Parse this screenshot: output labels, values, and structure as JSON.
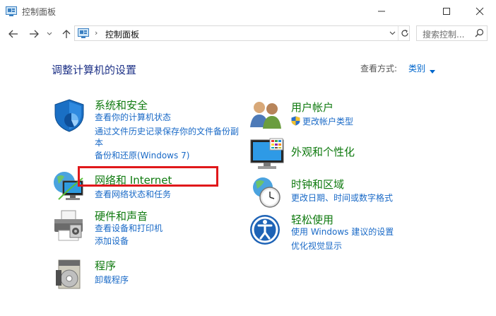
{
  "window": {
    "title": "控制面板"
  },
  "address": {
    "path": "控制面板",
    "separator": "›"
  },
  "search": {
    "placeholder": "搜索控制..."
  },
  "header": {
    "title": "调整计算机的设置",
    "view_by_label": "查看方式:",
    "view_by_value": "类别"
  },
  "left_categories": [
    {
      "title": "系统和安全",
      "links": [
        "查看你的计算机状态",
        "通过文件历史记录保存你的文件备份副",
        "本",
        "备份和还原(Windows 7)"
      ]
    },
    {
      "title": "网络和 Internet",
      "links": [
        "查看网络状态和任务"
      ]
    },
    {
      "title": "硬件和声音",
      "links": [
        "查看设备和打印机",
        "添加设备"
      ]
    },
    {
      "title": "程序",
      "links": [
        "卸载程序"
      ]
    }
  ],
  "right_categories": [
    {
      "title": "用户帐户",
      "links": [
        "更改帐户类型"
      ]
    },
    {
      "title": "外观和个性化",
      "links": []
    },
    {
      "title": "时钟和区域",
      "links": [
        "更改日期、时间或数字格式"
      ]
    },
    {
      "title": "轻松使用",
      "links": [
        "使用 Windows 建议的设置",
        "优化视觉显示"
      ]
    }
  ],
  "colors": {
    "category_title": "#0f7a0f",
    "link": "#1a6ac7",
    "highlight": "#e0181b",
    "page_title": "#1e3287"
  }
}
